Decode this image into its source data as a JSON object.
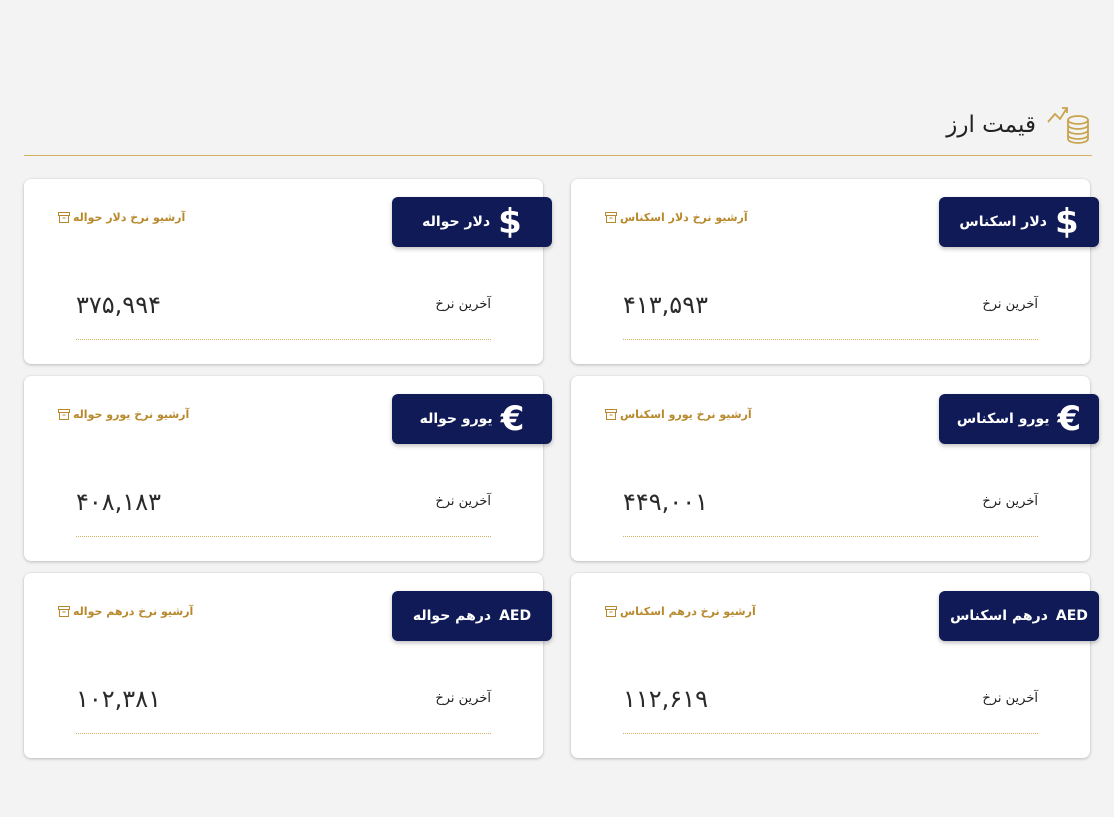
{
  "header": {
    "title": "قیمت ارز",
    "icon": "coins-chart-icon"
  },
  "colors": {
    "badge": "#0f1a57",
    "accent": "#b8892c",
    "line": "#d4b064"
  },
  "cards": [
    {
      "name": "dollar-cash",
      "symbol": "$",
      "label": "دلار اسکناس",
      "archive": "آرشیو نرخ دلار اسکناس",
      "rate_label": "آخرین نرخ",
      "value": "۴۱۳,۵۹۳"
    },
    {
      "name": "dollar-remittance",
      "symbol": "$",
      "label": "دلار حواله",
      "archive": "آرشیو نرخ دلار حواله",
      "rate_label": "آخرین نرخ",
      "value": "۳۷۵,۹۹۴"
    },
    {
      "name": "euro-cash",
      "symbol": "€",
      "label": "یورو اسکناس",
      "archive": "آرشیو نرخ یورو اسکناس",
      "rate_label": "آخرین نرخ",
      "value": "۴۴۹,۰۰۱"
    },
    {
      "name": "euro-remittance",
      "symbol": "€",
      "label": "یورو حواله",
      "archive": "آرشیو نرخ یورو حواله",
      "rate_label": "آخرین نرخ",
      "value": "۴۰۸,۱۸۳"
    },
    {
      "name": "dirham-cash",
      "symbol": "AED",
      "label": "درهم اسکناس",
      "archive": "آرشیو نرخ درهم اسکناس",
      "rate_label": "آخرین نرخ",
      "value": "۱۱۲,۶۱۹"
    },
    {
      "name": "dirham-remittance",
      "symbol": "AED",
      "label": "درهم حواله",
      "archive": "آرشیو نرخ درهم حواله",
      "rate_label": "آخرین نرخ",
      "value": "۱۰۲,۳۸۱"
    }
  ]
}
